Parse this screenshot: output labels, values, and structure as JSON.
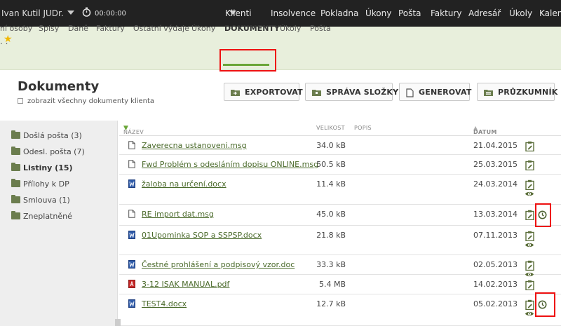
{
  "topbar": {
    "user_name": "Ivan Kutil JUDr.",
    "timer": "00:00:00",
    "nav": [
      "Klienti",
      "Insolvence",
      "Pokladna",
      "Úkony",
      "Pošta",
      "Faktury",
      "Adresář",
      "Úkoly",
      "Kalen"
    ]
  },
  "header": {
    "dots": ". .",
    "subnav": [
      "ní osoby",
      "Spisy",
      "Daně",
      "Faktury",
      "Ostatní výdaje",
      "Úkony",
      "DOKUMENTY",
      "Úkoly",
      "Pošta"
    ]
  },
  "page": {
    "title": "Dokumenty",
    "show_all_label": "zobrazit všechny dokumenty klienta"
  },
  "toolbar": {
    "export": "EXPORTOVAT",
    "folders": "SPRÁVA SLOŽKY",
    "generate": "GENEROVAT",
    "explorer": "PRŮZKUMNÍK"
  },
  "sidebar": {
    "folders": [
      {
        "label": "Došlá pošta (3)",
        "bold": false
      },
      {
        "label": "Odesl. pošta (7)",
        "bold": false
      },
      {
        "label": "Listiny (15)",
        "bold": true
      },
      {
        "label": "Přílohy k DP",
        "bold": false
      },
      {
        "label": "Smlouva (1)",
        "bold": false
      },
      {
        "label": "Zneplatněné",
        "bold": false
      }
    ]
  },
  "table": {
    "col_name": "NÁZEV",
    "col_size": "VELIKOST",
    "col_desc": "POPIS",
    "col_date": "DATUM",
    "rows": [
      {
        "name": "Zaverecna ustanoveni.msg",
        "size": "34.0 kB",
        "date": "21.04.2015",
        "type": "msg",
        "eye": false,
        "history": false
      },
      {
        "name": "Fwd Problém s odesláním dopisu ONLINE.msg",
        "size": "50.5 kB",
        "date": "25.03.2015",
        "type": "msg",
        "eye": false,
        "history": false
      },
      {
        "name": "žaloba na určení.docx",
        "size": "11.4 kB",
        "date": "24.03.2014",
        "type": "docx",
        "eye": true,
        "history": false
      },
      {
        "name": "RE import dat.msg",
        "size": "45.0 kB",
        "date": "13.03.2014",
        "type": "msg",
        "eye": false,
        "history": true
      },
      {
        "name": "01Upominka SOP a SSPSP.docx",
        "size": "21.8 kB",
        "date": "07.11.2013",
        "type": "docx",
        "eye": true,
        "history": false
      },
      {
        "name": "Čestné prohlášení a podpisový vzor.doc",
        "size": "33.3 kB",
        "date": "02.05.2013",
        "type": "docx",
        "eye": true,
        "history": false
      },
      {
        "name": "3-12 ISAK MANUAL.pdf",
        "size": "5.4 MB",
        "date": "14.02.2013",
        "type": "pdf",
        "eye": false,
        "history": false
      },
      {
        "name": "TEST4.docx",
        "size": "12.7 kB",
        "date": "05.02.2013",
        "type": "docx",
        "eye": true,
        "history": true
      }
    ]
  },
  "colors": {
    "topbar": "#222222",
    "band": "#e8efdc",
    "accent_green": "#6aa638",
    "link_green": "#4a6a2a",
    "highlight_red": "#ee1111"
  }
}
